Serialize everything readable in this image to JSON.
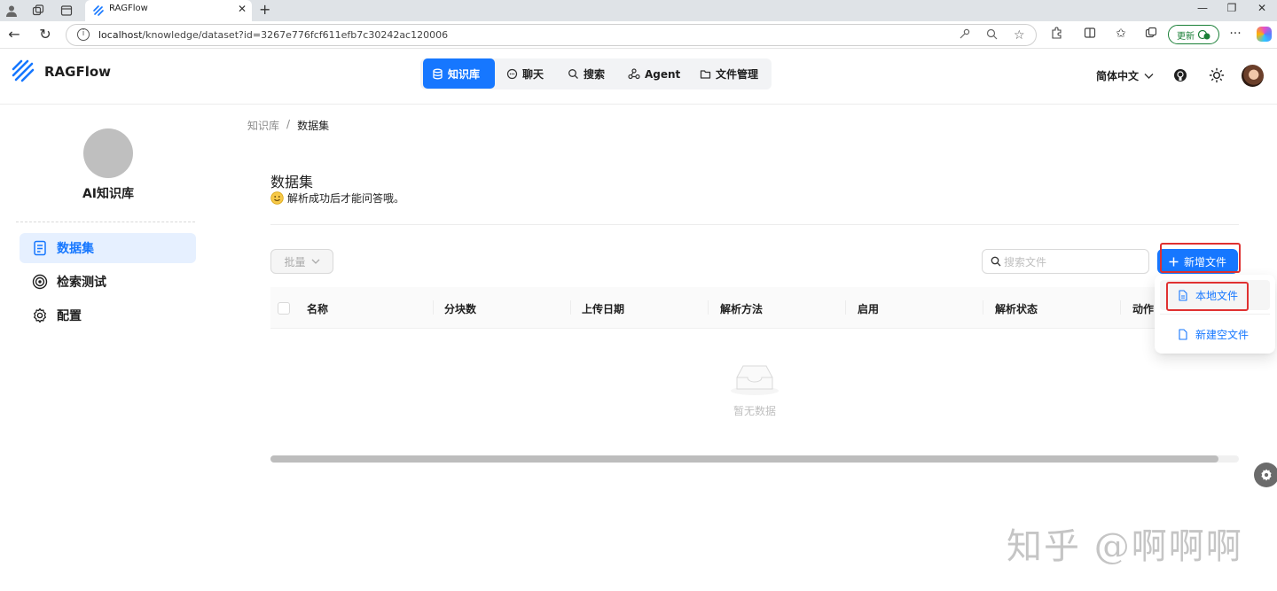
{
  "browser": {
    "tab_title": "RAGFlow",
    "url_host": "localhost",
    "url_path": "/knowledge/dataset?id=3267e776fcf611efb7c30242ac120006",
    "update_label": "更新"
  },
  "app": {
    "brand": "RAGFlow",
    "nav": [
      {
        "label": "知识库",
        "icon": "database-icon",
        "active": true
      },
      {
        "label": "聊天",
        "icon": "chat-icon",
        "active": false
      },
      {
        "label": "搜索",
        "icon": "search-icon",
        "active": false
      },
      {
        "label": "Agent",
        "icon": "agent-icon",
        "active": false
      },
      {
        "label": "文件管理",
        "icon": "folder-icon",
        "active": false
      }
    ],
    "language": "简体中文",
    "accent": "#1677ff"
  },
  "sidebar": {
    "kb_name": "AI知识库",
    "items": [
      {
        "label": "数据集",
        "icon": "document-icon",
        "active": true
      },
      {
        "label": "检索测试",
        "icon": "target-icon",
        "active": false
      },
      {
        "label": "配置",
        "icon": "gear-icon",
        "active": false
      }
    ]
  },
  "breadcrumb": {
    "root": "知识库",
    "sep": "/",
    "current": "数据集"
  },
  "page": {
    "title": "数据集",
    "description": "解析成功后才能问答哦。",
    "desc_icon": "smile-emoji-icon"
  },
  "toolbar": {
    "bulk_label": "批量",
    "search_placeholder": "搜索文件",
    "add_label": "新增文件"
  },
  "table": {
    "columns": [
      "名称",
      "分块数",
      "上传日期",
      "解析方法",
      "启用",
      "解析状态",
      "动作"
    ],
    "empty_text": "暂无数据"
  },
  "add_menu": {
    "items": [
      "本地文件",
      "新建空文件"
    ]
  },
  "watermark": "知乎 @啊啊啊"
}
